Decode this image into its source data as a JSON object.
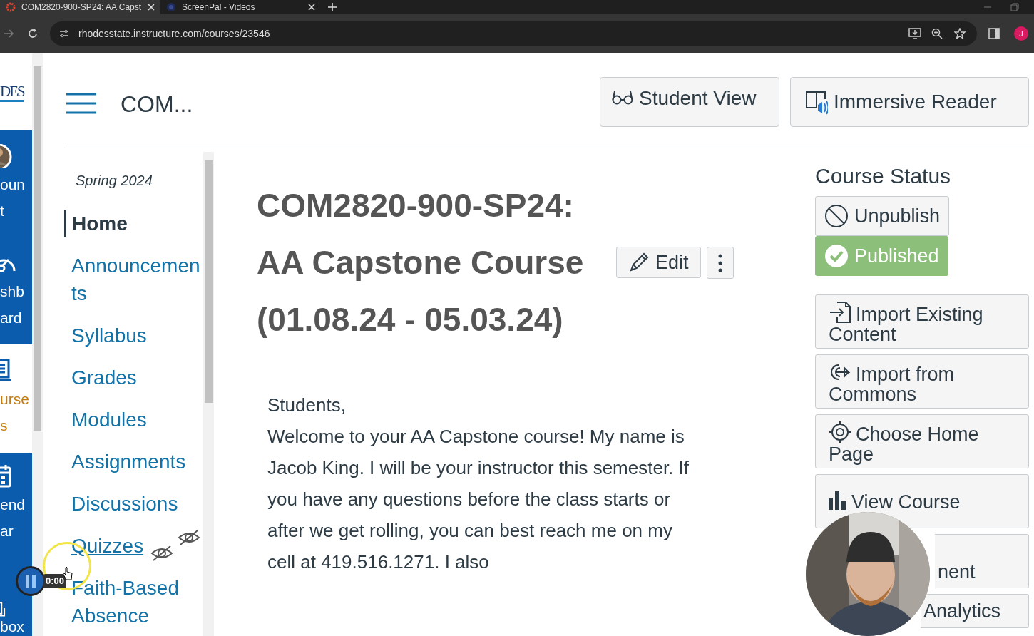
{
  "browser": {
    "tabs": [
      {
        "title": "COM2820-900-SP24: AA Capst",
        "selected": true
      },
      {
        "title": "ScreenPal - Videos",
        "selected": false
      }
    ],
    "url": "rhodesstate.instructure.com/courses/23546",
    "avatar": "J"
  },
  "global_nav": {
    "logo": "DES",
    "items": [
      {
        "kind": "account",
        "lines": [
          "oun",
          "t"
        ],
        "selected": false
      },
      {
        "kind": "dashboard",
        "lines": [
          "shb",
          "ard"
        ],
        "selected": false
      },
      {
        "kind": "courses",
        "lines": [
          "urse",
          "s"
        ],
        "selected": true
      },
      {
        "kind": "calendar",
        "lines": [
          "end",
          "ar"
        ],
        "selected": false
      },
      {
        "kind": "inbox",
        "lines": [
          "box"
        ],
        "selected": false
      }
    ]
  },
  "header": {
    "title": "COM...",
    "buttons": [
      {
        "kind": "student",
        "label": "Student View"
      },
      {
        "kind": "reader",
        "label": "Immersive Reader"
      }
    ]
  },
  "course_nav": {
    "term": "Spring 2024",
    "items": [
      {
        "label": "Home",
        "selected": true,
        "hidden": false
      },
      {
        "label": "Announcements",
        "selected": false,
        "hidden": false
      },
      {
        "label": "Syllabus",
        "selected": false,
        "hidden": false
      },
      {
        "label": "Grades",
        "selected": false,
        "hidden": false
      },
      {
        "label": "Modules",
        "selected": false,
        "hidden": false
      },
      {
        "label": "Assignments",
        "selected": false,
        "hidden": false
      },
      {
        "label": "Discussions",
        "selected": false,
        "hidden": false
      },
      {
        "label": "Quizzes",
        "selected": false,
        "hidden": true
      },
      {
        "label": "Faith-Based Absence",
        "selected": false,
        "hidden": false
      }
    ]
  },
  "page": {
    "title": "COM2820-900-SP24: AA Capstone Course (01.08.24 - 05.03.24)",
    "edit": "Edit",
    "greeting": "Students,",
    "body": "Welcome to your AA Capstone course! My name is Jacob King. I will be your instructor this semester. If you have any questions before the class starts or after we get rolling, you can best reach me on my cell at 419.516.1271. I also"
  },
  "sidebar": {
    "heading": "Course Status",
    "status": [
      {
        "label": "Unpublish",
        "selected": false
      },
      {
        "label": "Published",
        "selected": true
      }
    ],
    "actions": [
      {
        "kind": "import",
        "label": "Import Existing Content",
        "covered": false
      },
      {
        "kind": "commons",
        "label": "Import from Commons",
        "covered": false
      },
      {
        "kind": "home",
        "label": "Choose Home Page",
        "covered": false
      },
      {
        "kind": "stream",
        "label": "View Course",
        "covered": false
      },
      {
        "kind": "none",
        "label": "nent",
        "covered": true
      },
      {
        "kind": "none",
        "label": "Analytics",
        "covered": true
      }
    ]
  },
  "recorder": {
    "timer": "0:00"
  }
}
